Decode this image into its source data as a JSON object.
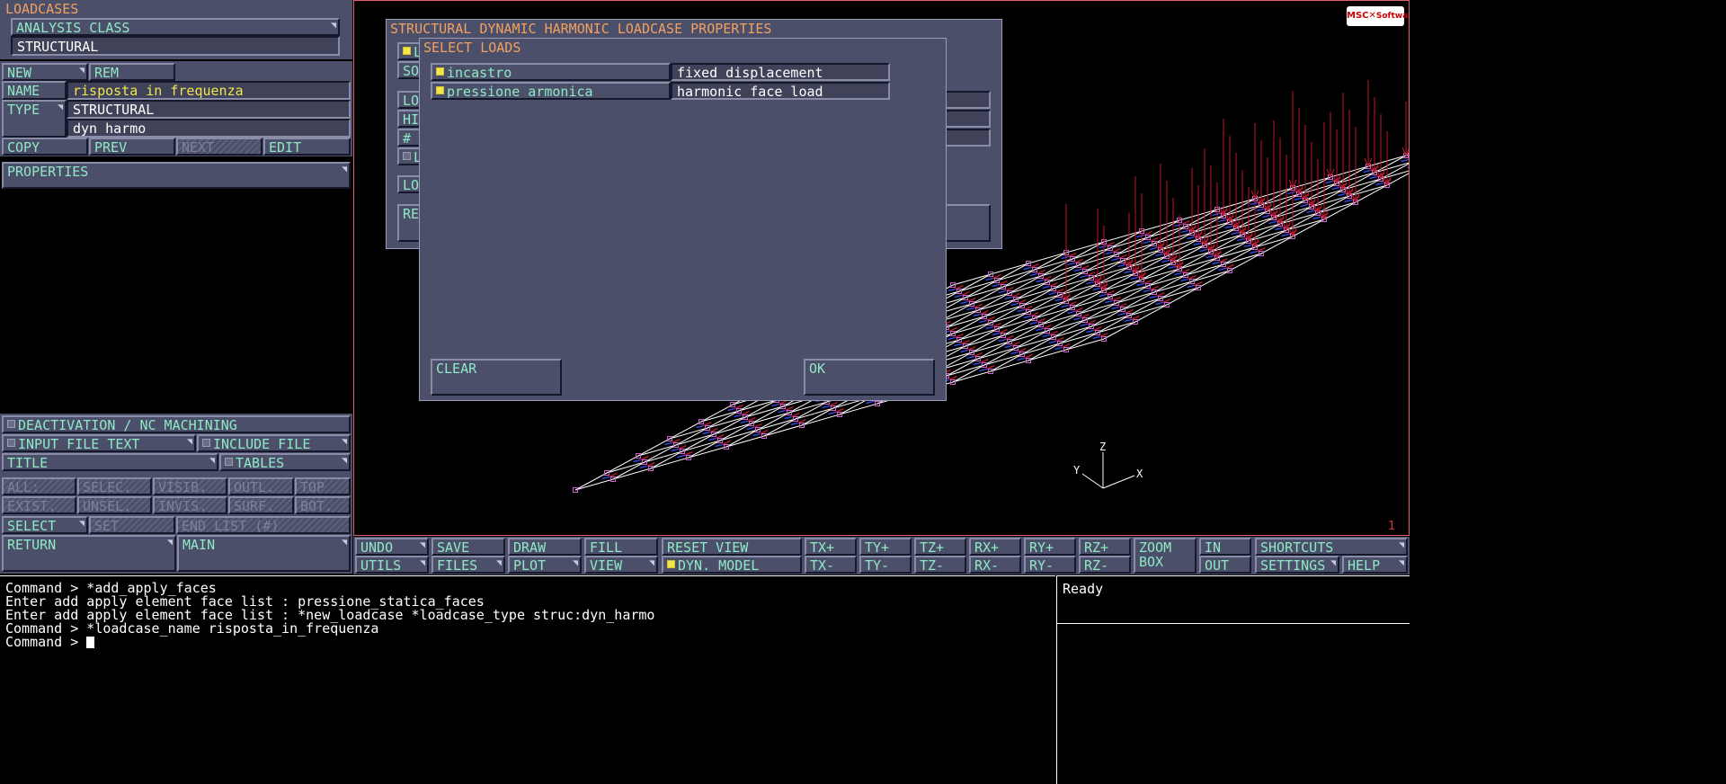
{
  "left_panel": {
    "header": "LOADCASES",
    "analysis_class_label": "ANALYSIS CLASS",
    "analysis_class_value": "STRUCTURAL",
    "new_label": "NEW",
    "rem_label": "REM",
    "name_label": "NAME",
    "name_value": "risposta_in_frequenza",
    "type_label": "TYPE",
    "type_value1": "STRUCTURAL",
    "type_value2": "dyn_harmo",
    "copy_label": "COPY",
    "prev_label": "PREV",
    "next_label": "NEXT",
    "edit_label": "EDIT",
    "properties_label": "PROPERTIES",
    "deactivation_label": "DEACTIVATION / NC MACHINING",
    "input_file_text_label": "INPUT FILE TEXT",
    "include_file_label": "INCLUDE FILE",
    "title_label": "TITLE",
    "tables_label": "TABLES",
    "sel_row1": [
      "ALL:",
      "SELEC.",
      "VISIB.",
      "OUTL.",
      "TOP"
    ],
    "sel_row2": [
      "EXIST.",
      "UNSEL.",
      "INVIS.",
      "SURF.",
      "BOT."
    ],
    "select_label": "SELECT",
    "set_label": "SET",
    "end_list_label": "END LIST (#)",
    "return_label": "RETURN",
    "main_label": "MAIN"
  },
  "harmonic_dialog": {
    "title": "STRUCTURAL DYNAMIC HARMONIC LOADCASE PROPERTIES",
    "partial_buttons": [
      "LO",
      "SOL",
      "LOW",
      "HIG",
      "# F",
      "LO",
      "LOA",
      "RES"
    ]
  },
  "select_loads": {
    "title": "SELECT LOADS",
    "loads": [
      {
        "name": "incastro",
        "type": "fixed_displacement"
      },
      {
        "name": "pressione_armonica",
        "type": "harmonic_face_load"
      }
    ],
    "clear_label": "CLEAR",
    "ok_label": "OK"
  },
  "viewport": {
    "brand_text": "MSC",
    "brand_sub": "Software",
    "viewport_number": "1",
    "axis_x": "X",
    "axis_y": "Y",
    "axis_z": "Z"
  },
  "toolbar": {
    "row1": {
      "undo": "UNDO",
      "save": "SAVE",
      "draw": "DRAW",
      "fill": "FILL",
      "reset_view": "RESET VIEW",
      "tx_plus": "TX+",
      "ty_plus": "TY+",
      "tz_plus": "TZ+",
      "rx_plus": "RX+",
      "ry_plus": "RY+",
      "rz_plus": "RZ+",
      "zoom_box_1": "ZOOM",
      "zoom_box_2": "BOX",
      "in": "IN",
      "shortcuts": "SHORTCUTS"
    },
    "row2": {
      "utils": "UTILS",
      "files": "FILES",
      "plot": "PLOT",
      "view": "VIEW",
      "dyn_model": "DYN. MODEL",
      "tx_minus": "TX-",
      "ty_minus": "TY-",
      "tz_minus": "TZ-",
      "rx_minus": "RX-",
      "ry_minus": "RY-",
      "rz_minus": "RZ-",
      "out": "OUT",
      "settings": "SETTINGS",
      "help": "HELP"
    }
  },
  "command_area": {
    "lines": [
      "Command > *add_apply_faces",
      "Enter add apply element face list : pressione_statica_faces",
      "Enter add apply element face list : *new_loadcase *loadcase_type struc:dyn_harmo",
      "Command > *loadcase_name risposta_in_frequenza",
      "Command > "
    ],
    "status": "Ready"
  },
  "colors": {
    "panel_bg": "#4c4f6a",
    "label_green": "#8ee9c4",
    "value_yellow": "#f2e64e",
    "title_orange": "#f2a060",
    "mesh_magenta": "#d060d0",
    "arrow_red": "#c0182c"
  }
}
